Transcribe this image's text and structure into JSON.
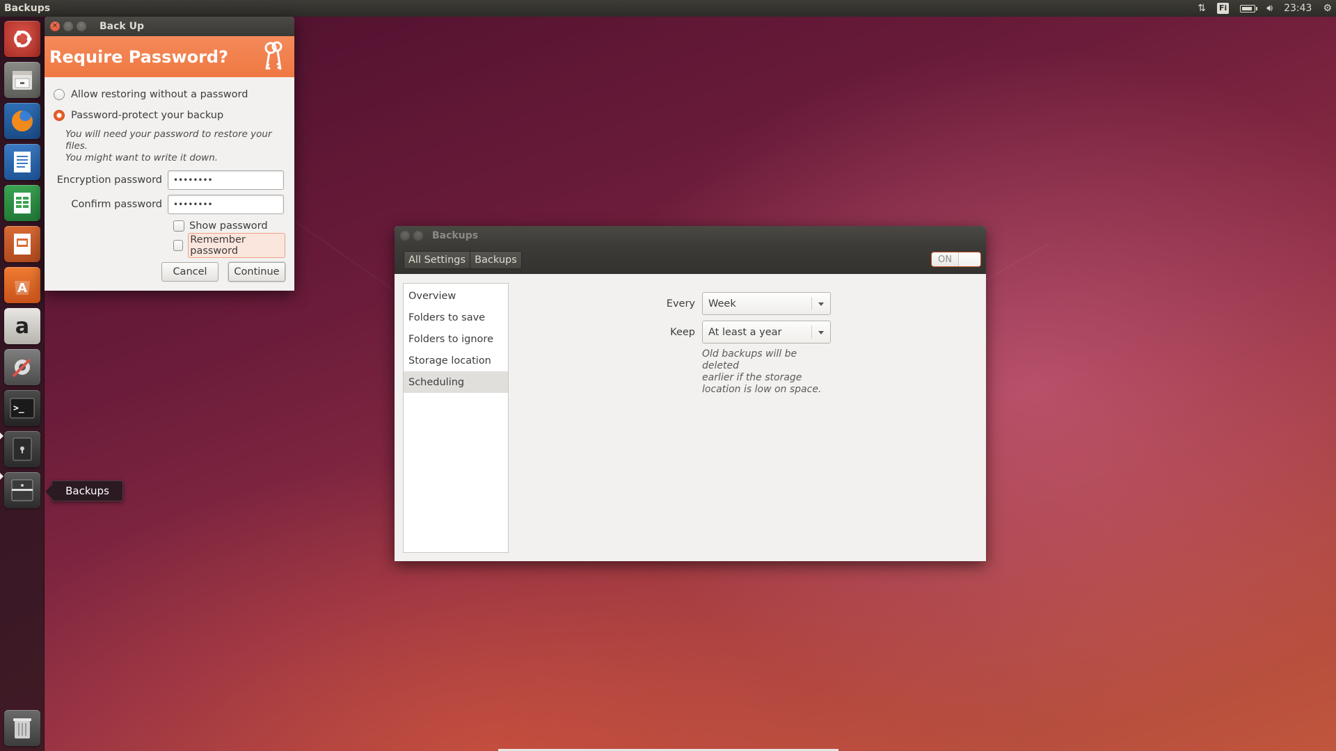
{
  "top_panel": {
    "app_title": "Backups",
    "keyboard_layout": "Fi",
    "clock": "23:43",
    "battery_level": 0.7
  },
  "launcher": {
    "items": [
      {
        "name": "dash",
        "icon": "ubuntu-logo-icon"
      },
      {
        "name": "files",
        "icon": "file-cabinet-icon"
      },
      {
        "name": "firefox",
        "icon": "firefox-icon"
      },
      {
        "name": "writer",
        "icon": "document-icon"
      },
      {
        "name": "calc",
        "icon": "spreadsheet-icon"
      },
      {
        "name": "impress",
        "icon": "presentation-icon"
      },
      {
        "name": "software-center",
        "icon": "shopping-bag-icon"
      },
      {
        "name": "amazon",
        "icon": "amazon-icon",
        "glyph": "a"
      },
      {
        "name": "system-settings",
        "icon": "settings-tools-icon"
      },
      {
        "name": "terminal",
        "icon": "terminal-icon",
        "glyph": ">_"
      },
      {
        "name": "keyring",
        "icon": "safe-icon"
      },
      {
        "name": "backups",
        "icon": "backups-safe-icon"
      },
      {
        "name": "trash",
        "icon": "trash-icon"
      }
    ],
    "tooltip": "Backups"
  },
  "backup_dialog": {
    "window_title": "Back Up",
    "heading": "Require Password?",
    "options": {
      "allow_without_password": "Allow restoring without a password",
      "password_protect": "Password-protect your backup"
    },
    "hint_line1": "You will need your password to restore your files.",
    "hint_line2": "You might want to write it down.",
    "encryption_label": "Encryption password",
    "encryption_value": "••••••••",
    "confirm_label": "Confirm password",
    "confirm_value": "••••••••",
    "show_password": "Show password",
    "remember_password": "Remember password",
    "cancel": "Cancel",
    "continue": "Continue"
  },
  "backups_window": {
    "window_title": "Backups",
    "breadcrumb": [
      "All Settings",
      "Backups"
    ],
    "switch_label": "ON",
    "sidebar": [
      "Overview",
      "Folders to save",
      "Folders to ignore",
      "Storage location",
      "Scheduling"
    ],
    "selected_index": 4,
    "every_label": "Every",
    "every_value": "Week",
    "keep_label": "Keep",
    "keep_value": "At least a year",
    "note_lines": [
      "Old backups will be deleted",
      "earlier if the storage",
      "location is low on space."
    ]
  },
  "colors": {
    "accent": "#ef7843",
    "panel": "#3c3b37",
    "window_bg": "#f2f1f0"
  }
}
